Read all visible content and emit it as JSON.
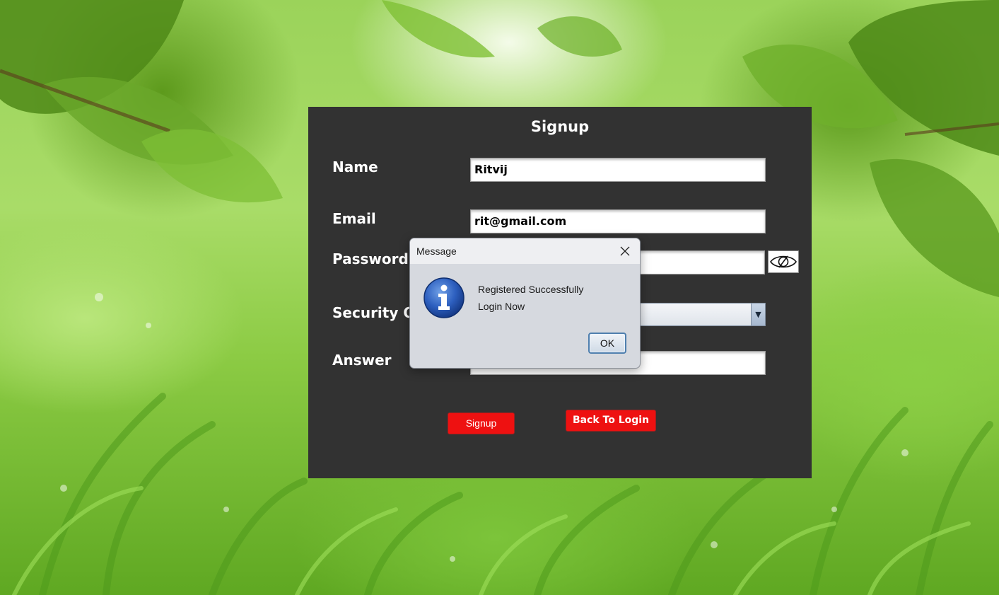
{
  "signup_form": {
    "title": "Signup",
    "name_label": "Name",
    "name_value": "Ritvij",
    "email_label": "Email",
    "email_value": "rit@gmail.com",
    "password_label": "Password",
    "security_question_label": "Security Q",
    "answer_label": "Answer",
    "signup_button": "Signup",
    "back_to_login_button": "Back To Login"
  },
  "dialog": {
    "title": "Message",
    "message_line1": "Registered Successfully",
    "message_line2": "Login Now",
    "ok_button": "OK",
    "icon": "info-icon"
  },
  "colors": {
    "panel_background": "#323232",
    "button_red": "#ee1111",
    "dialog_background": "#d6d9df",
    "background_green": "#8ccb44"
  }
}
